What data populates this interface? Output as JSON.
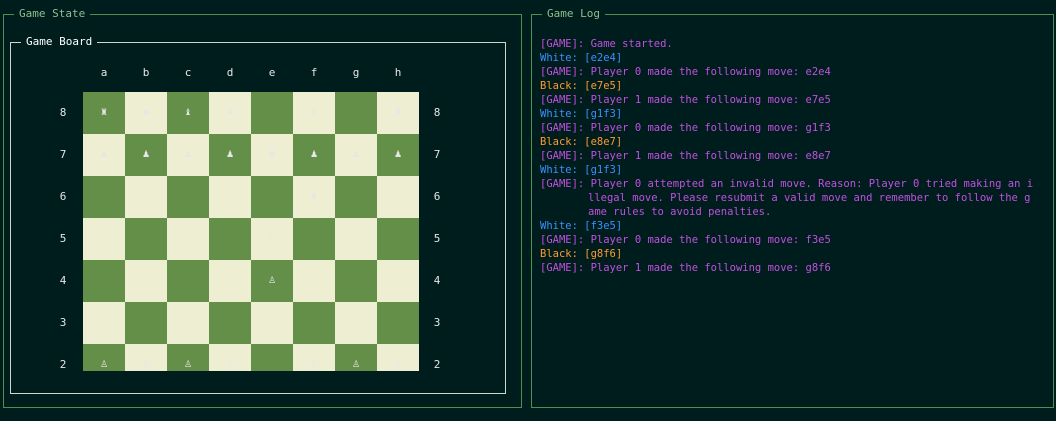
{
  "panels": {
    "game_state_title": "Game State",
    "game_board_title": "Game Board",
    "game_log_title": "Game Log"
  },
  "board": {
    "files": [
      "a",
      "b",
      "c",
      "d",
      "e",
      "f",
      "g",
      "h"
    ],
    "ranks": [
      "8",
      "7",
      "6",
      "5",
      "4",
      "3",
      "2"
    ],
    "pieces": {
      "8": [
        "♜",
        "♞",
        "♝",
        "♛",
        "",
        "♝",
        "",
        "♜"
      ],
      "7": [
        "♟",
        "♟",
        "♟",
        "♟",
        "♚",
        "♟",
        "♟",
        "♟"
      ],
      "6": [
        "",
        "",
        "",
        "",
        "",
        "♞",
        "",
        ""
      ],
      "5": [
        "",
        "",
        "",
        "",
        "♘",
        "",
        "",
        ""
      ],
      "4": [
        "",
        "",
        "",
        "",
        "♙",
        "",
        "",
        ""
      ],
      "3": [
        "",
        "",
        "",
        "",
        "",
        "",
        "",
        ""
      ],
      "2": [
        "♙",
        "♙",
        "♙",
        "♙",
        "",
        "♙",
        "♙",
        "♙"
      ]
    }
  },
  "log": [
    {
      "type": "game",
      "text": "[GAME]: Game started."
    },
    {
      "type": "white",
      "text": "White: [e2e4]"
    },
    {
      "type": "game",
      "text": "[GAME]: Player 0 made the following move: e2e4"
    },
    {
      "type": "black",
      "text": "Black: [e7e5]"
    },
    {
      "type": "game",
      "text": "[GAME]: Player 1 made the following move: e7e5"
    },
    {
      "type": "white",
      "text": "White: [g1f3]"
    },
    {
      "type": "game",
      "text": "[GAME]: Player 0 made the following move: g1f3"
    },
    {
      "type": "black",
      "text": "Black: [e8e7]"
    },
    {
      "type": "game",
      "text": "[GAME]: Player 1 made the following move: e8e7"
    },
    {
      "type": "white",
      "text": "White: [g1f3]"
    },
    {
      "type": "game",
      "text": "[GAME]: Player 0 attempted an invalid move. Reason: Player 0 tried making an i",
      "cont": [
        "llegal move. Please resubmit a valid move and remember to follow the g",
        "ame rules to avoid penalties."
      ]
    },
    {
      "type": "white",
      "text": "White: [f3e5]"
    },
    {
      "type": "game",
      "text": "[GAME]: Player 0 made the following move: f3e5"
    },
    {
      "type": "black",
      "text": "Black: [g8f6]"
    },
    {
      "type": "game",
      "text": "[GAME]: Player 1 made the following move: g8f6"
    }
  ]
}
